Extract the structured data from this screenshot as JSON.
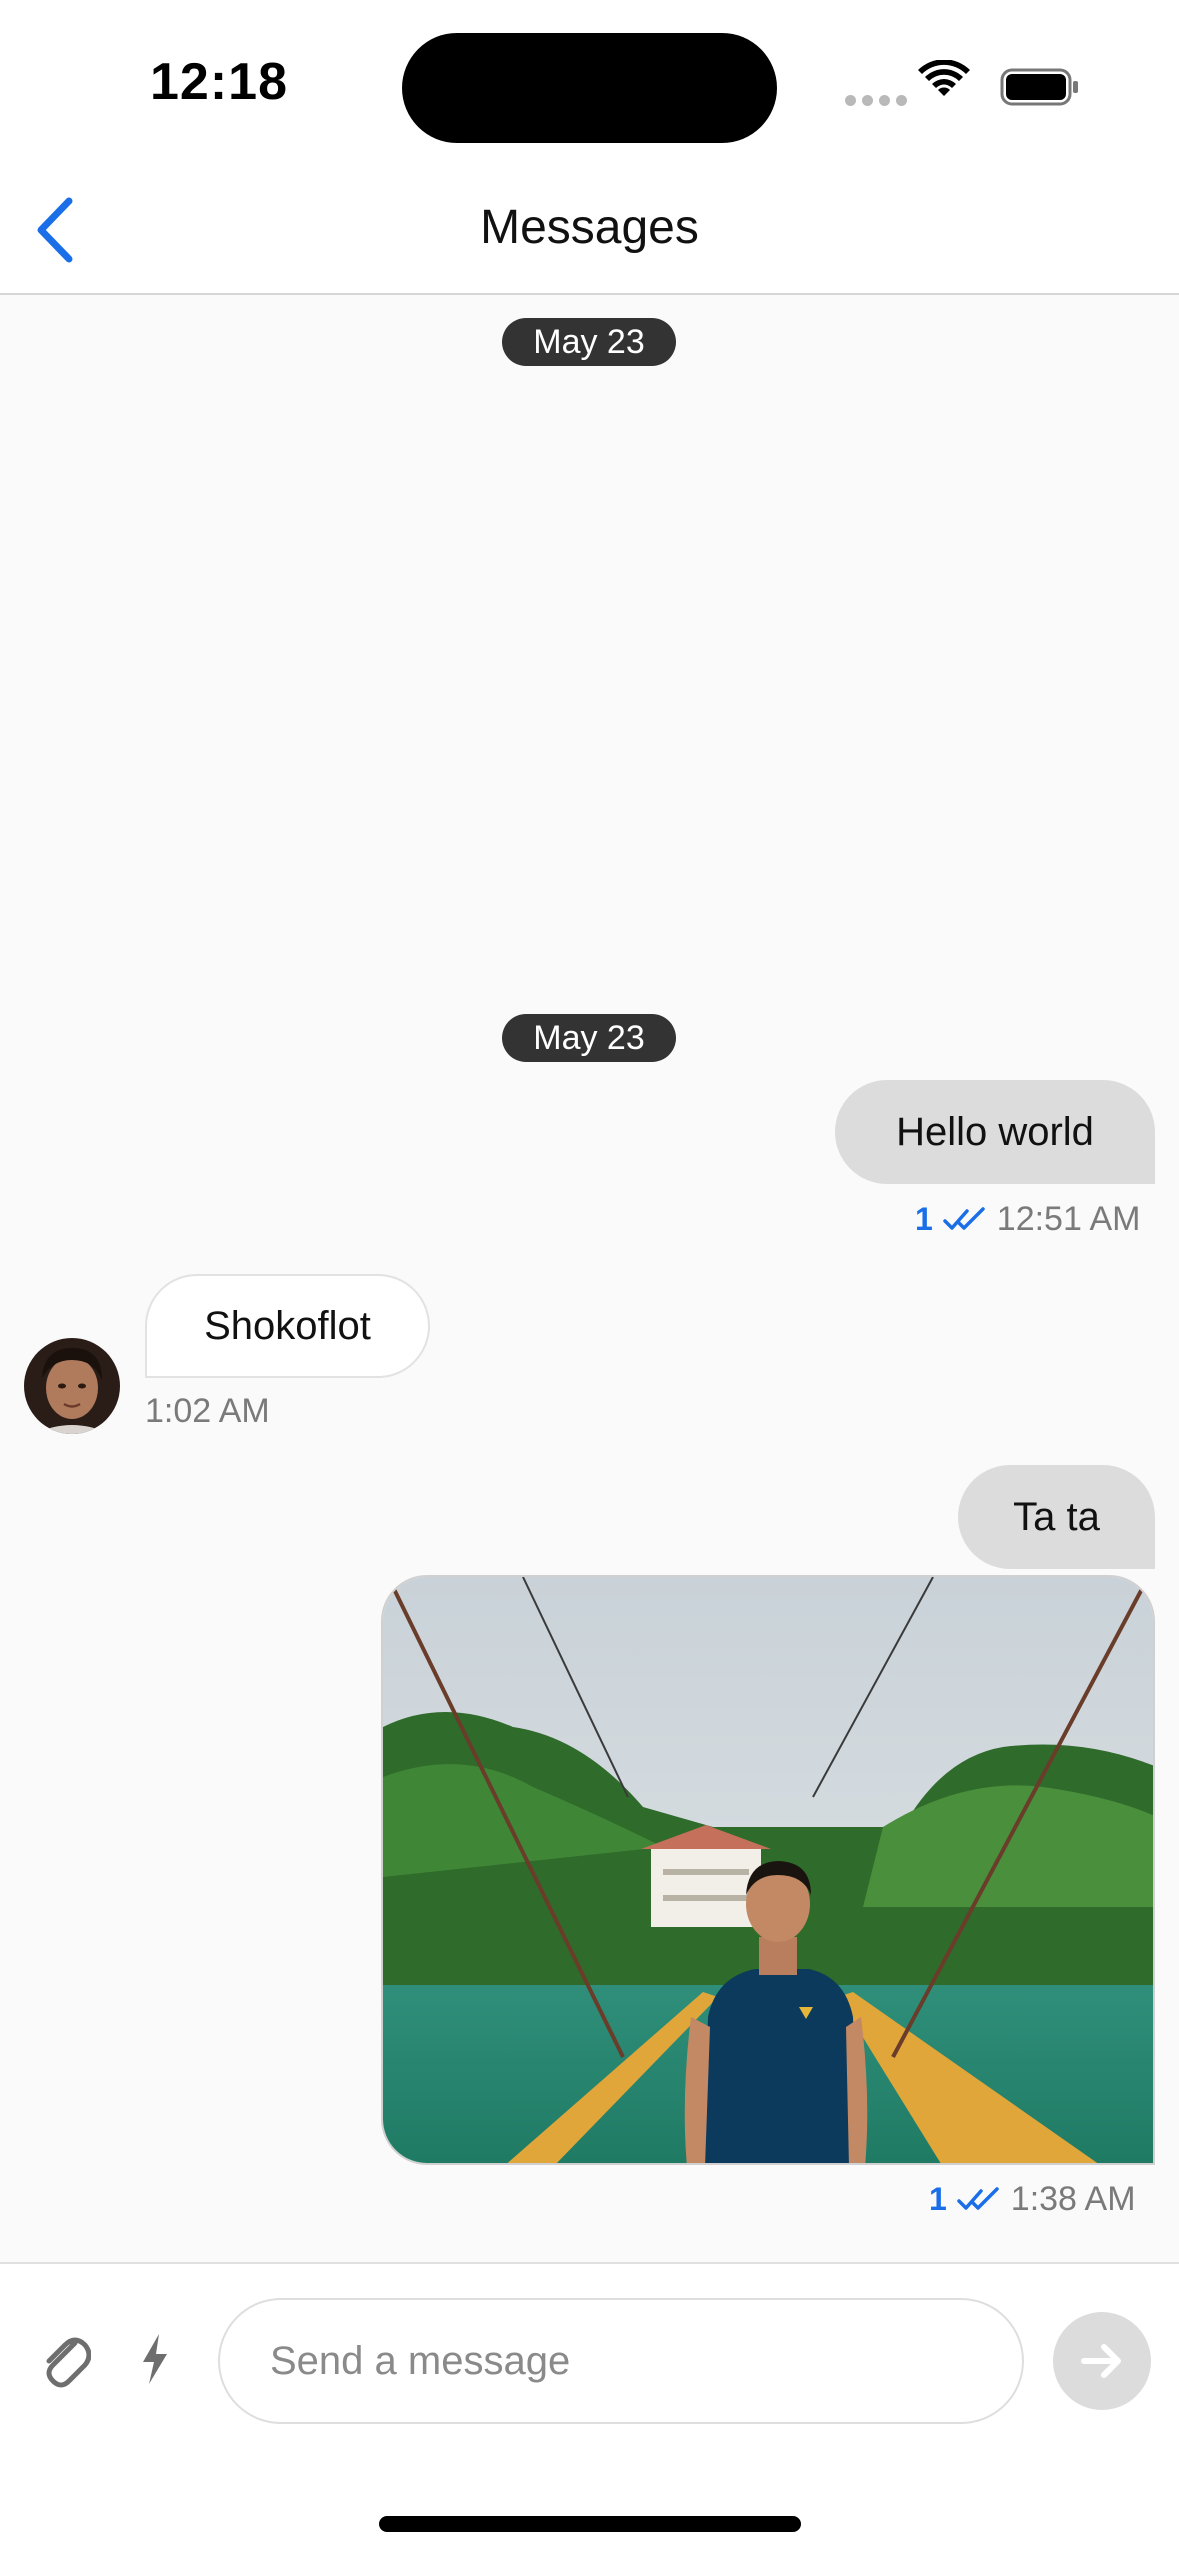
{
  "status_bar": {
    "time": "12:18"
  },
  "nav": {
    "title": "Messages",
    "back_icon": "chevron-left-icon"
  },
  "dates": [
    "May 23",
    "May 23"
  ],
  "messages": [
    {
      "direction": "outgoing",
      "text": "Hello world",
      "read_count": "1",
      "time": "12:51 AM"
    },
    {
      "direction": "incoming",
      "text": "Shokoflot",
      "time": "1:02 AM"
    },
    {
      "direction": "outgoing",
      "text": "Ta ta"
    },
    {
      "direction": "outgoing",
      "type": "image",
      "read_count": "1",
      "time": "1:38 AM"
    }
  ],
  "composer": {
    "placeholder": "Send a message",
    "value": ""
  },
  "colors": {
    "accent": "#1a6fe8",
    "outgoing_bubble": "#dcdcdc",
    "date_pill": "#333333",
    "background": "#fafafa"
  }
}
